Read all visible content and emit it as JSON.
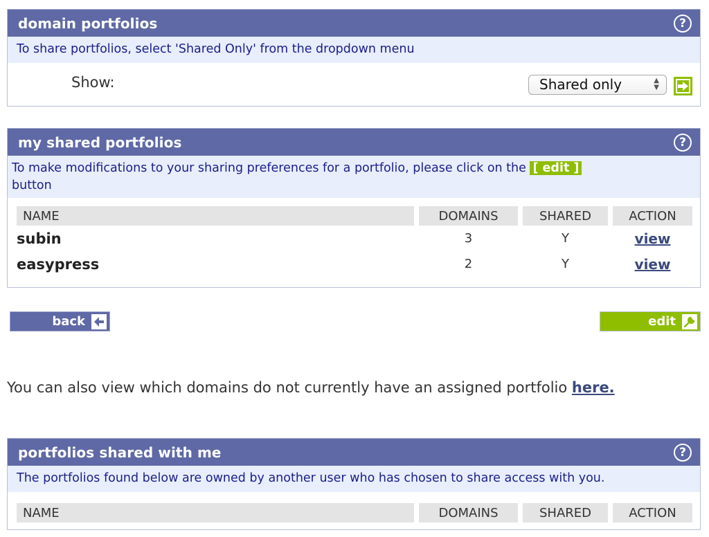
{
  "domain_portfolios": {
    "title": "domain portfolios",
    "help_icon": "help-circle-icon",
    "note": "To share portfolios, select 'Shared Only' from the dropdown menu",
    "show_label": "Show:",
    "show_select_value": "Shared only",
    "go_button_icon": "arrow-right-icon"
  },
  "my_shared": {
    "title": "my shared portfolios",
    "help_icon": "help-circle-icon",
    "note_before": " To make modifications to your sharing preferences for a portfolio, please click on the ",
    "note_badge": "[ edit ]",
    "note_after": " button",
    "columns": [
      "NAME",
      "DOMAINS",
      "SHARED",
      "ACTION"
    ],
    "rows": [
      {
        "name": "subin",
        "domains": "3",
        "shared": "Y",
        "action": "view"
      },
      {
        "name": "easypress",
        "domains": "2",
        "shared": "Y",
        "action": "view"
      }
    ]
  },
  "buttons": {
    "back_label": "back",
    "back_icon": "arrow-left-icon",
    "edit_label": "edit",
    "edit_icon": "wrench-icon",
    "back_color": "#5f69a5",
    "edit_color": "#8fbe00"
  },
  "info": {
    "text": "You can also view which domains do not currently have an assigned portfolio ",
    "link": "here."
  },
  "shared_with_me": {
    "title": "portfolios shared with me",
    "help_icon": "help-circle-icon",
    "note": "The portfolios found below are owned by another user who has chosen to share access with you.",
    "columns": [
      "NAME",
      "DOMAINS",
      "SHARED",
      "ACTION"
    ]
  }
}
